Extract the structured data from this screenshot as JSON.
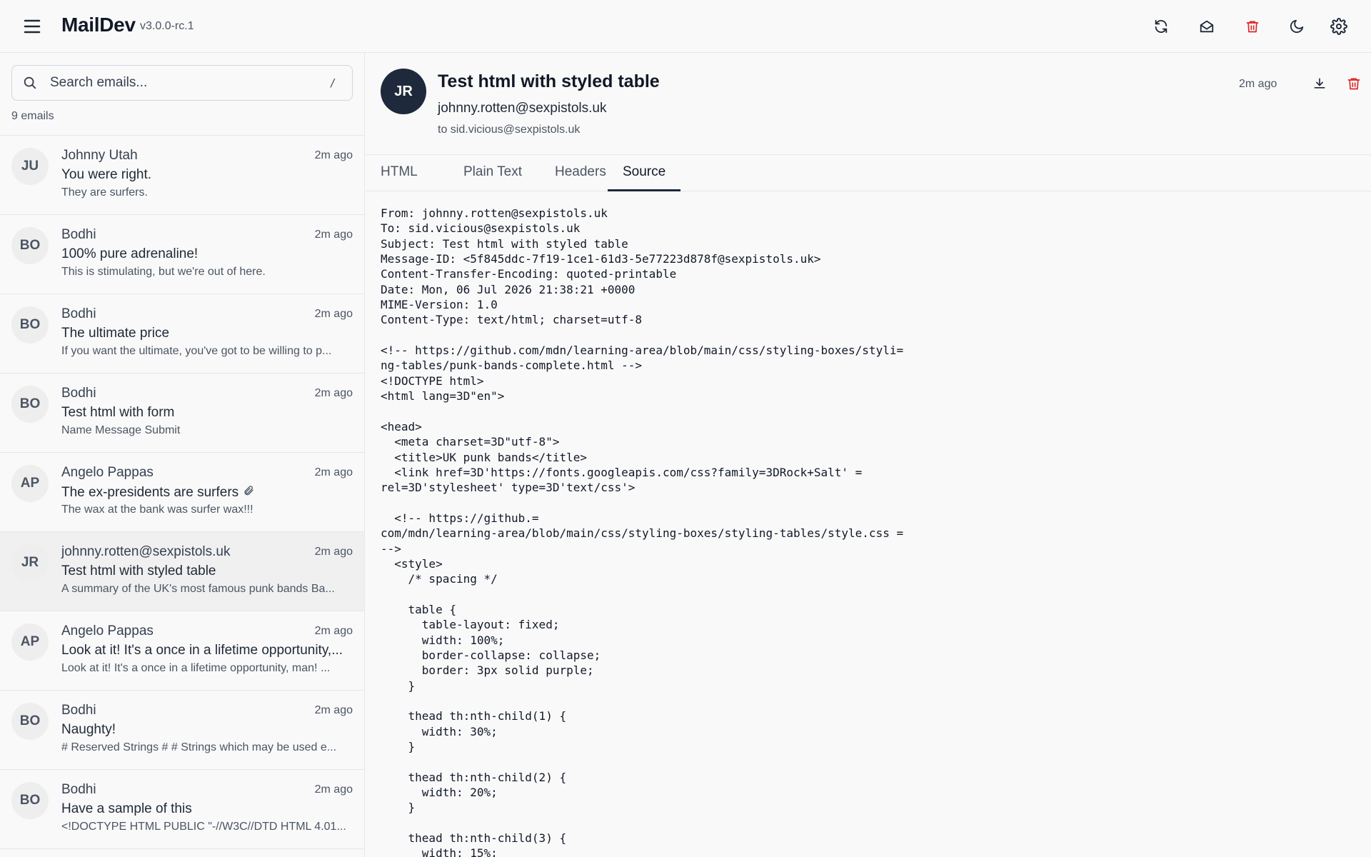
{
  "app": {
    "name": "MailDev",
    "version": "v3.0.0-rc.1"
  },
  "toolbar": {
    "icons": [
      "menu-icon",
      "refresh-icon",
      "mark-all-read-icon",
      "delete-all-icon",
      "dark-mode-icon",
      "settings-icon"
    ]
  },
  "search": {
    "placeholder": "Search emails...",
    "shortcut": "/",
    "value": ""
  },
  "list": {
    "count_label": "9 emails",
    "items": [
      {
        "initials": "JU",
        "from": "Johnny Utah",
        "time": "2m ago",
        "subject": "You were right.",
        "preview": "They are surfers.",
        "attachment": false,
        "selected": false
      },
      {
        "initials": "BO",
        "from": "Bodhi",
        "time": "2m ago",
        "subject": "100% pure adrenaline!",
        "preview": "This is stimulating, but we're out of here.",
        "attachment": false,
        "selected": false
      },
      {
        "initials": "BO",
        "from": "Bodhi",
        "time": "2m ago",
        "subject": "The ultimate price",
        "preview": "If you want the ultimate, you've got to be willing to p...",
        "attachment": false,
        "selected": false
      },
      {
        "initials": "BO",
        "from": "Bodhi",
        "time": "2m ago",
        "subject": "Test html with form",
        "preview": "Name Message Submit",
        "attachment": false,
        "selected": false
      },
      {
        "initials": "AP",
        "from": "Angelo Pappas",
        "time": "2m ago",
        "subject": "The ex-presidents are surfers",
        "preview": "The wax at the bank was surfer wax!!!",
        "attachment": true,
        "selected": false
      },
      {
        "initials": "JR",
        "from": "johnny.rotten@sexpistols.uk",
        "time": "2m ago",
        "subject": "Test html with styled table",
        "preview": "A summary of the UK's most famous punk bands Ba...",
        "attachment": false,
        "selected": true
      },
      {
        "initials": "AP",
        "from": "Angelo Pappas",
        "time": "2m ago",
        "subject": "Look at it! It's a once in a lifetime opportunity,...",
        "preview": "Look at it! It's a once in a lifetime opportunity, man! ...",
        "attachment": false,
        "selected": false
      },
      {
        "initials": "BO",
        "from": "Bodhi",
        "time": "2m ago",
        "subject": "Naughty!",
        "preview": "# Reserved Strings # # Strings which may be used e...",
        "attachment": false,
        "selected": false
      },
      {
        "initials": "BO",
        "from": "Bodhi",
        "time": "2m ago",
        "subject": "Have a sample of this",
        "preview": "<!DOCTYPE HTML PUBLIC \"-//W3C//DTD HTML 4.01...",
        "attachment": false,
        "selected": false
      }
    ]
  },
  "message": {
    "initials": "JR",
    "subject": "Test html with styled table",
    "from": "johnny.rotten@sexpistols.uk",
    "to": "to sid.vicious@sexpistols.uk",
    "time": "2m ago",
    "tabs": [
      {
        "label": "HTML",
        "active": false
      },
      {
        "label": "Plain Text",
        "active": false
      },
      {
        "label": "Headers",
        "active": false
      },
      {
        "label": "Source",
        "active": true
      }
    ],
    "source_lines": [
      "From: johnny.rotten@sexpistols.uk",
      "To: sid.vicious@sexpistols.uk",
      "Subject: Test html with styled table",
      "Message-ID: <5f845ddc-7f19-1ce1-61d3-5e77223d878f@sexpistols.uk>",
      "Content-Transfer-Encoding: quoted-printable",
      "Date: Mon, 06 Jul 2026 21:38:21 +0000",
      "MIME-Version: 1.0",
      "Content-Type: text/html; charset=utf-8",
      "",
      "<!-- https://github.com/mdn/learning-area/blob/main/css/styling-boxes/styli=",
      "ng-tables/punk-bands-complete.html -->",
      "<!DOCTYPE html>",
      "<html lang=3D\"en\">",
      "",
      "<head>",
      "  <meta charset=3D\"utf-8\">",
      "  <title>UK punk bands</title>",
      "  <link href=3D'https://fonts.googleapis.com/css?family=3DRock+Salt' =",
      "rel=3D'stylesheet' type=3D'text/css'>",
      "",
      "  <!-- https://github.=",
      "com/mdn/learning-area/blob/main/css/styling-boxes/styling-tables/style.css =",
      "-->",
      "  <style>",
      "    /* spacing */",
      "",
      "    table {",
      "      table-layout: fixed;",
      "      width: 100%;",
      "      border-collapse: collapse;",
      "      border: 3px solid purple;",
      "    }",
      "",
      "    thead th:nth-child(1) {",
      "      width: 30%;",
      "    }",
      "",
      "    thead th:nth-child(2) {",
      "      width: 20%;",
      "    }",
      "",
      "    thead th:nth-child(3) {",
      "      width: 15%;"
    ]
  },
  "colors": {
    "danger": "#dc2626",
    "avatar_dark": "#1e293b",
    "border": "#e5e7eb"
  }
}
